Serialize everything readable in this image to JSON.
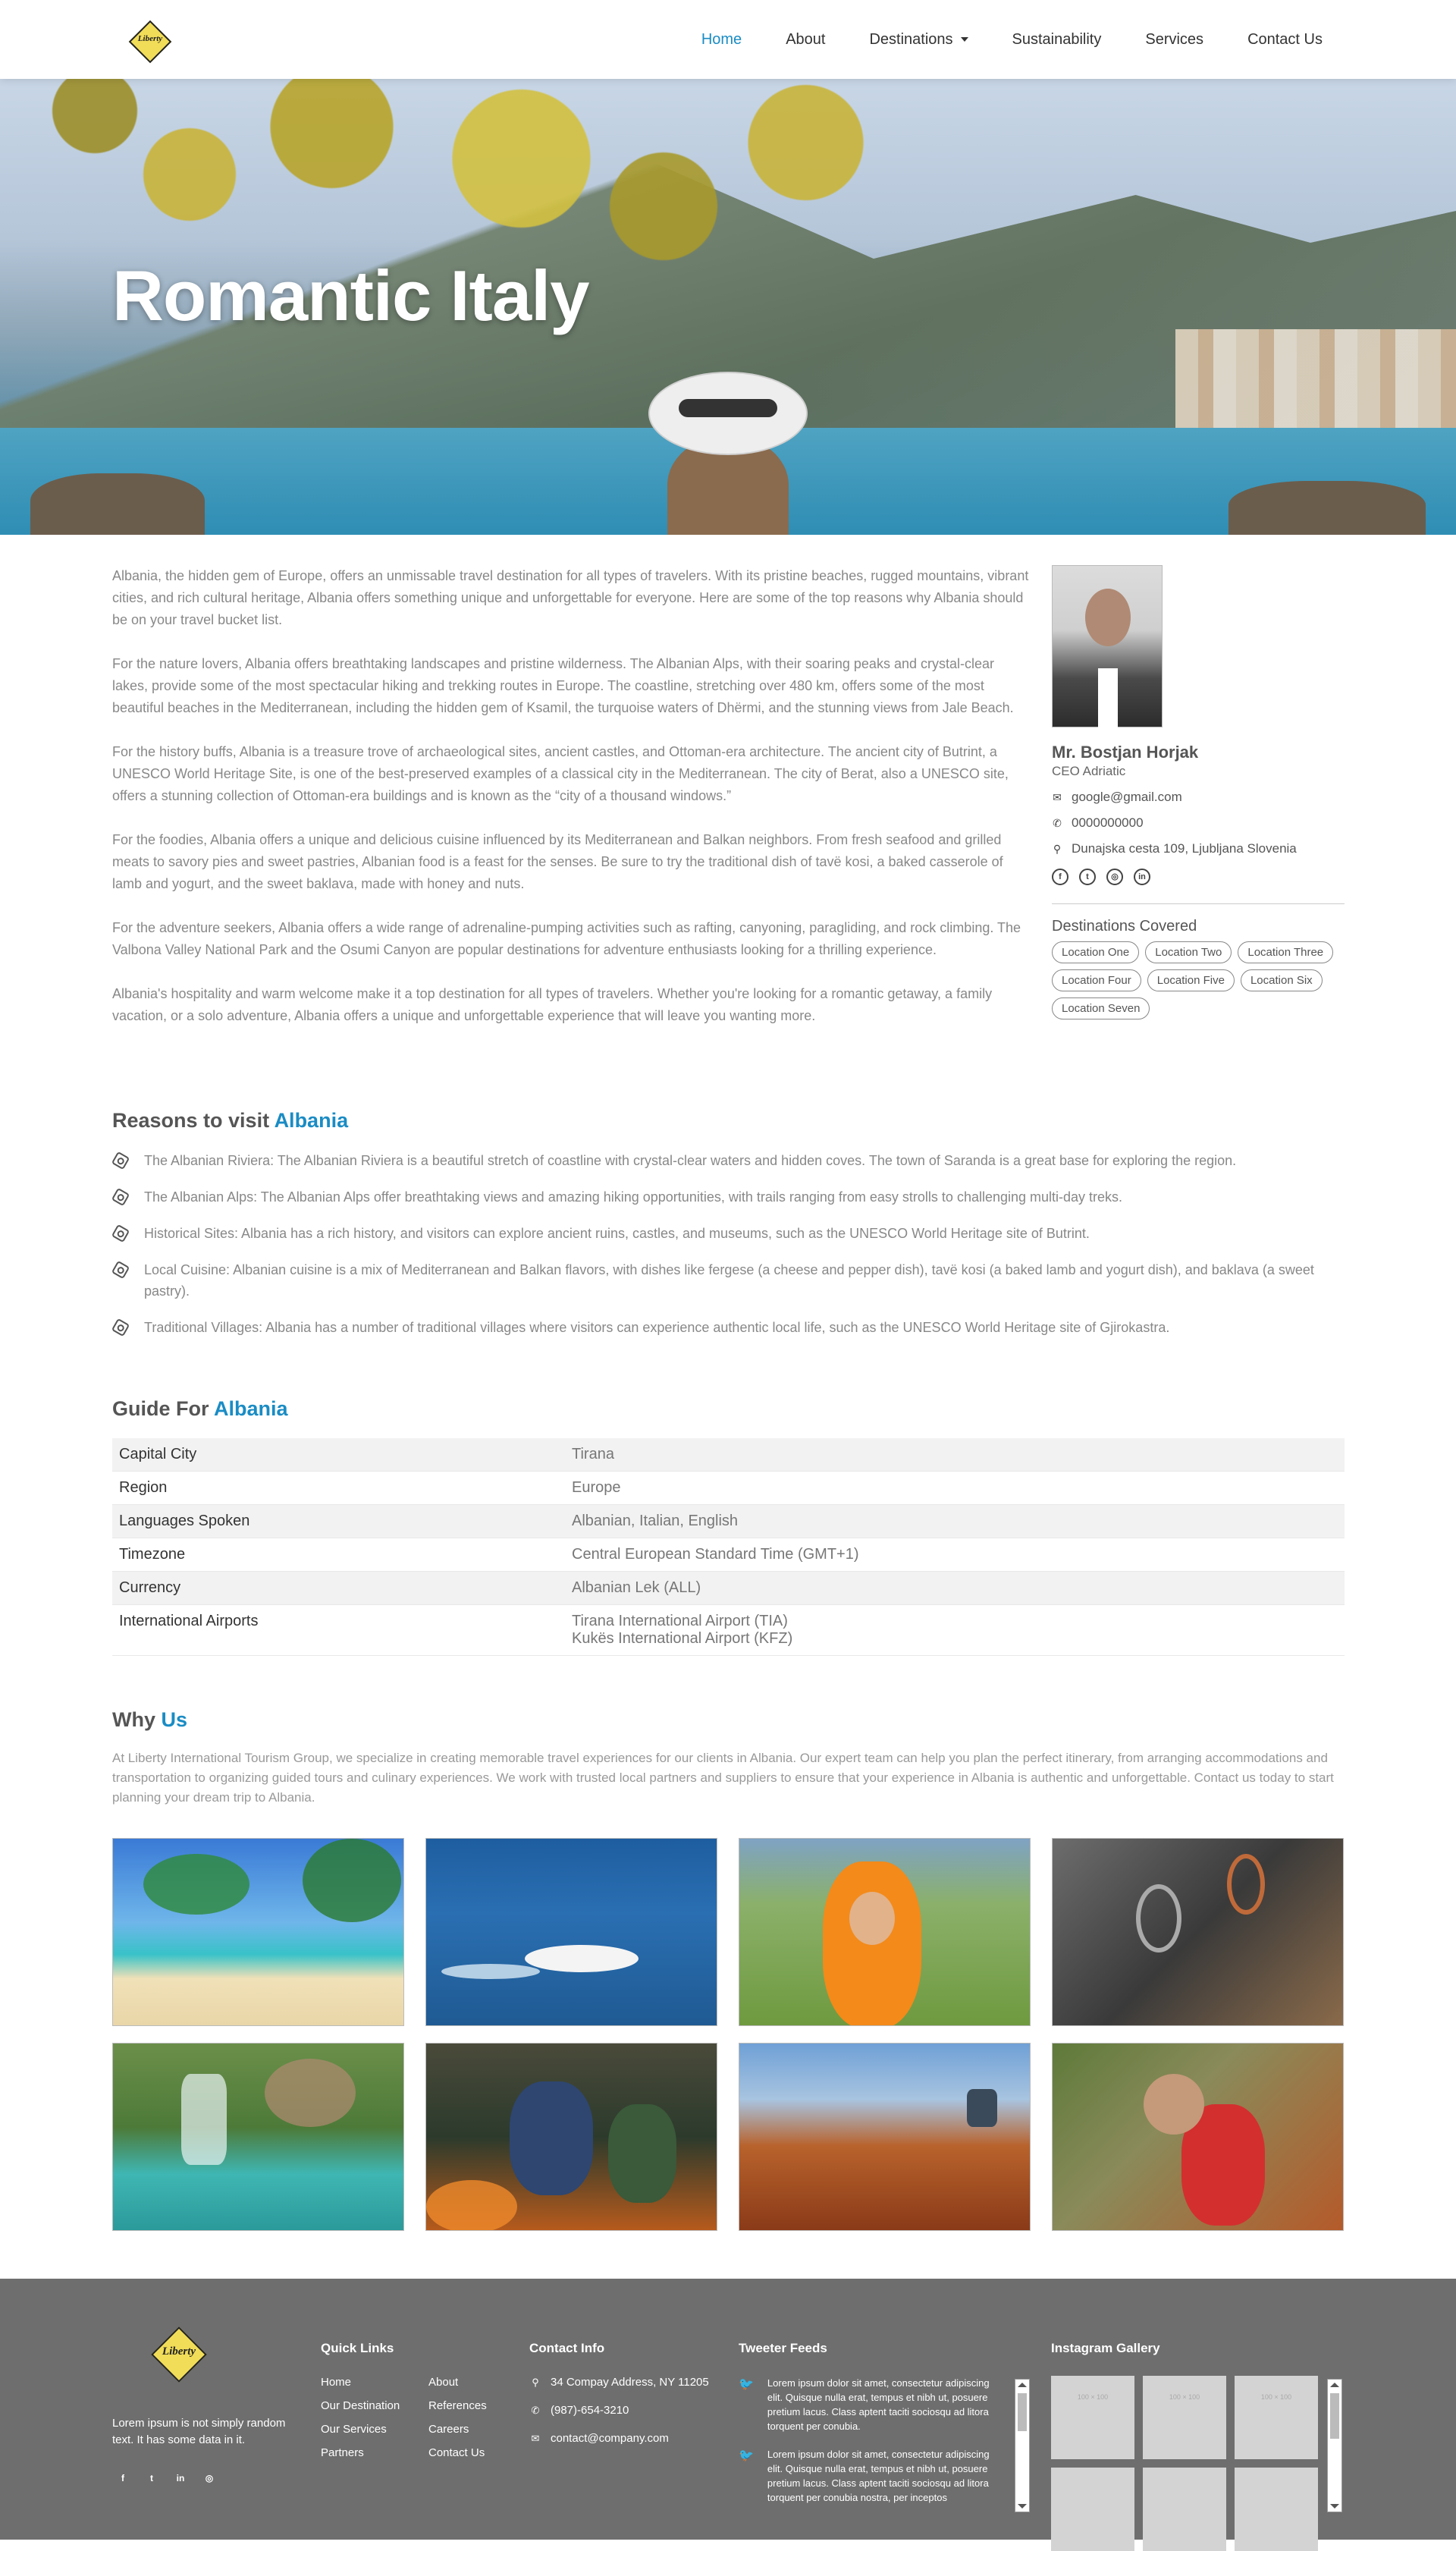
{
  "nav": {
    "logo_text": "Liberty",
    "items": [
      {
        "label": "Home",
        "active": true
      },
      {
        "label": "About"
      },
      {
        "label": "Destinations",
        "dropdown": true
      },
      {
        "label": "Sustainability"
      },
      {
        "label": "Services"
      },
      {
        "label": "Contact Us"
      }
    ]
  },
  "hero": {
    "title": "Romantic Italy"
  },
  "intro": [
    "Albania, the hidden gem of Europe, offers an unmissable travel destination for all types of travelers. With its pristine beaches, rugged mountains, vibrant cities, and rich cultural heritage, Albania offers something unique and unforgettable for everyone. Here are some of the top reasons why Albania should be on your travel bucket list.",
    "For the nature lovers, Albania offers breathtaking landscapes and pristine wilderness. The Albanian Alps, with their soaring peaks and crystal-clear lakes, provide some of the most spectacular hiking and trekking routes in Europe. The coastline, stretching over 480 km, offers some of the most beautiful beaches in the Mediterranean, including the hidden gem of Ksamil, the turquoise waters of Dhërmi, and the stunning views from Jale Beach.",
    "For the history buffs, Albania is a treasure trove of archaeological sites, ancient castles, and Ottoman-era architecture. The ancient city of Butrint, a UNESCO World Heritage Site, is one of the best-preserved examples of a classical city in the Mediterranean. The city of Berat, also a UNESCO site, offers a stunning collection of Ottoman-era buildings and is known as the “city of a thousand windows.”",
    "For the foodies, Albania offers a unique and delicious cuisine influenced by its Mediterranean and Balkan neighbors. From fresh seafood and grilled meats to savory pies and sweet pastries, Albanian food is a feast for the senses. Be sure to try the traditional dish of tavë kosi, a baked casserole of lamb and yogurt, and the sweet baklava, made with honey and nuts.",
    "For the adventure seekers, Albania offers a wide range of adrenaline-pumping activities such as rafting, canyoning, paragliding, and rock climbing. The Valbona Valley National Park and the Osumi Canyon are popular destinations for adventure enthusiasts looking for a thrilling experience.",
    "Albania's hospitality and warm welcome make it a top destination for all types of travelers. Whether you're looking for a romantic getaway, a family vacation, or a solo adventure, Albania offers a unique and unforgettable experience that will leave you wanting more."
  ],
  "contact_card": {
    "name": "Mr. Bostjan Horjak",
    "role": "CEO Adriatic",
    "email": "google@gmail.com",
    "phone": "0000000000",
    "address": "Dunajska cesta 109, Ljubljana Slovenia",
    "destinations_title": "Destinations Covered",
    "destinations": [
      "Location One",
      "Location Two",
      "Location Three",
      "Location Four",
      "Location Five",
      "Location Six",
      "Location Seven"
    ]
  },
  "reasons": {
    "title_prefix": "Reasons to visit",
    "title_highlight": "Albania",
    "items": [
      "The Albanian Riviera: The Albanian Riviera is a beautiful stretch of coastline with crystal-clear waters and hidden coves. The town of Saranda is a great base for exploring the region.",
      "The Albanian Alps: The Albanian Alps offer breathtaking views and amazing hiking opportunities, with trails ranging from easy strolls to challenging multi-day treks.",
      "Historical Sites: Albania has a rich history, and visitors can explore ancient ruins, castles, and museums, such as the UNESCO World Heritage site of Butrint.",
      "Local Cuisine: Albanian cuisine is a mix of Mediterranean and Balkan flavors, with dishes like fergese (a cheese and pepper dish), tavë kosi (a baked lamb and yogurt dish), and baklava (a sweet pastry).",
      "Traditional Villages: Albania has a number of traditional villages where visitors can experience authentic local life, such as the UNESCO World Heritage site of Gjirokastra."
    ]
  },
  "guide": {
    "title_prefix": "Guide For",
    "title_highlight": "Albania",
    "rows": [
      {
        "key": "Capital City",
        "value": "Tirana"
      },
      {
        "key": "Region",
        "value": "Europe"
      },
      {
        "key": "Languages Spoken",
        "value": "Albanian, Italian, English"
      },
      {
        "key": "Timezone",
        "value": "Central European Standard Time (GMT+1)"
      },
      {
        "key": "Currency",
        "value": "Albanian Lek (ALL)"
      },
      {
        "key": "International Airports",
        "value": "Tirana International Airport (TIA)",
        "value2": "Kukës International Airport (KFZ)"
      }
    ]
  },
  "why": {
    "title_prefix": "Why",
    "title_highlight": "Us",
    "text": "At Liberty International Tourism Group, we specialize in creating memorable travel experiences for our clients in Albania. Our expert team can help you plan the perfect itinerary, from arranging accommodations and transportation to organizing guided tours and culinary experiences. We work with trusted local partners and suppliers to ensure that your experience in Albania is authentic and unforgettable. Contact us today to start planning your dream trip to Albania."
  },
  "footer": {
    "logo_text": "Liberty",
    "about": "Lorem ipsum is not simply random text. It has some data in it.",
    "quick_links_title": "Quick Links",
    "links": [
      "Home",
      "About",
      "Our Destination",
      "References",
      "Our Services",
      "Careers",
      "Partners",
      "Contact Us"
    ],
    "contact_title": "Contact Info",
    "address": "34 Compay Address, NY 11205",
    "phone": "(987)-654-3210",
    "email": "contact@company.com",
    "tweets_title": "Tweeter Feeds",
    "tweets": [
      "Lorem ipsum dolor sit amet, consectetur adipiscing elit. Quisque nulla erat, tempus et nibh ut, posuere pretium lacus. Class aptent taciti sociosqu ad litora torquent per conubia.",
      "Lorem ipsum dolor sit amet, consectetur adipiscing elit. Quisque nulla erat, tempus et nibh ut, posuere pretium lacus. Class aptent taciti sociosqu ad litora torquent per conubia nostra, per inceptos"
    ],
    "instagram_title": "Instagram Gallery",
    "instagram_placeholder": "100 × 100"
  },
  "colors": {
    "accent": "#1a8cc4",
    "footer_bg": "#6e6e6e",
    "logo_yellow": "#f1dd57"
  }
}
